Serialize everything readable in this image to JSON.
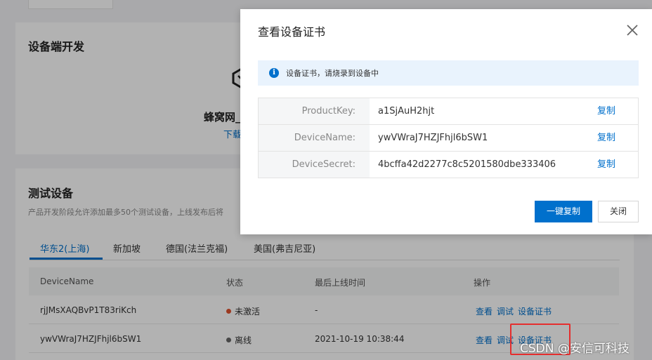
{
  "background": {
    "device_dev": {
      "title": "设备端开发",
      "product_name": "蜂窝网_",
      "download_link": "下载"
    },
    "test_devices": {
      "title": "测试设备",
      "description": "产品开发阶段允许添加最多50个测试设备，上线发布后将"
    },
    "tabs": [
      {
        "label": "华东2(上海)",
        "active": true
      },
      {
        "label": "新加坡",
        "active": false
      },
      {
        "label": "德国(法兰克福)",
        "active": false
      },
      {
        "label": "美国(弗吉尼亚)",
        "active": false
      }
    ],
    "table": {
      "columns": [
        "DeviceName",
        "状态",
        "最后上线时间",
        "操作"
      ],
      "rows": [
        {
          "device_name": "rjJMsXAQBvP1T83riKch",
          "status": "未激活",
          "status_color": "#e0522e",
          "last_online": "-",
          "actions": [
            "查看",
            "调试",
            "设备证书"
          ]
        },
        {
          "device_name": "ywVWraJ7HZJFhjl6bSW1",
          "status": "离线",
          "status_color": "#666666",
          "last_online": "2021-10-19 10:38:44",
          "actions": [
            "查看",
            "调试",
            "设备证书"
          ]
        }
      ]
    },
    "watermark": "CSDN @安信可科技"
  },
  "modal": {
    "title": "查看设备证书",
    "alert": "设备证书，请烧录到设备中",
    "fields": [
      {
        "key": "ProductKey",
        "value": "a1SjAuH2hjt",
        "copy": "复制"
      },
      {
        "key": "DeviceName",
        "value": "ywVWraJ7HZJFhjl6bSW1",
        "copy": "复制"
      },
      {
        "key": "DeviceSecret",
        "value": "4bcffa42d2277c8c5201580dbe333406",
        "copy": "复制"
      }
    ],
    "primary_button": "一键复制",
    "close_button": "关闭",
    "key_suffix": ":"
  },
  "colors": {
    "accent": "#0070cc",
    "highlight_box": "#e52d2d"
  }
}
